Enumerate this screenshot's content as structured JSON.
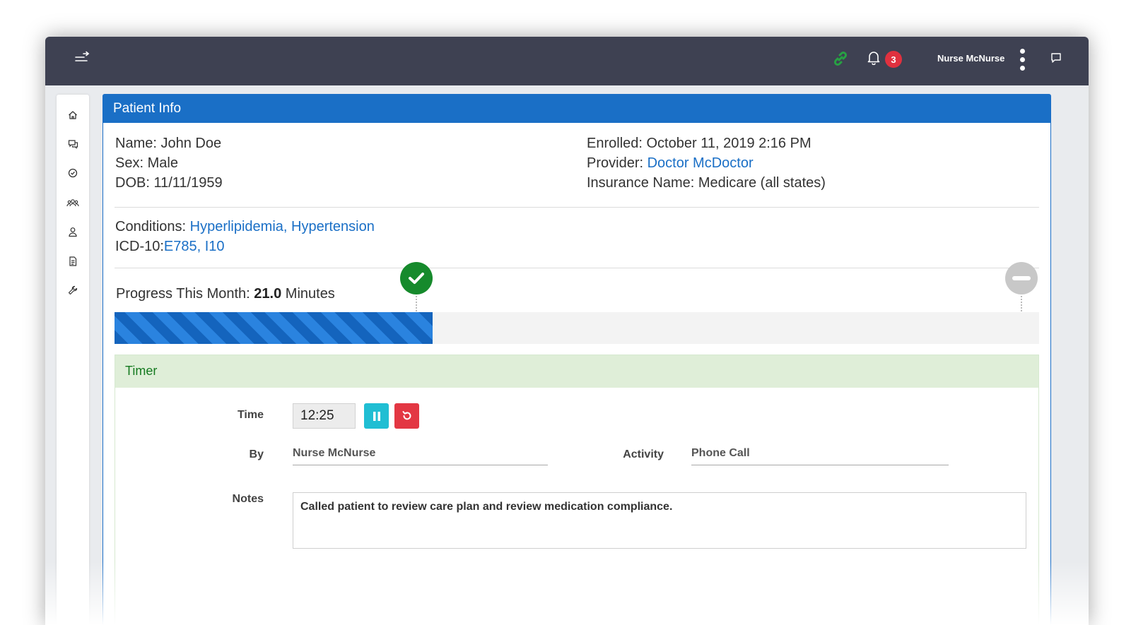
{
  "topbar": {
    "notification_count": "3",
    "user_name": "Nurse McNurse",
    "connection_color": "#27a243"
  },
  "sidebar": {
    "items": [
      {
        "icon": "home-icon"
      },
      {
        "icon": "chat-icon"
      },
      {
        "icon": "check-circle-icon"
      },
      {
        "icon": "group-icon"
      },
      {
        "icon": "user-icon"
      },
      {
        "icon": "document-icon"
      },
      {
        "icon": "wrench-icon"
      }
    ]
  },
  "patient": {
    "header": "Patient Info",
    "name_label": "Name:",
    "name": "John Doe",
    "sex_label": "Sex:",
    "sex": "Male",
    "dob_label": "DOB:",
    "dob": "11/11/1959",
    "enrolled_label": "Enrolled:",
    "enrolled": "October 11, 2019 2:16 PM",
    "provider_label": "Provider:",
    "provider": "Doctor McDoctor",
    "insurance_label": "Insurance Name:",
    "insurance": "Medicare (all states)",
    "conditions_label": "Conditions:",
    "conditions": "Hyperlipidemia, Hypertension",
    "icd_label": "ICD-10:",
    "icd": "E785, I10"
  },
  "progress": {
    "label": "Progress This Month:",
    "value": "21.0",
    "unit": "Minutes",
    "fill_fraction": 0.344
  },
  "timer": {
    "header": "Timer",
    "time_label": "Time",
    "time_value": "12:25",
    "by_label": "By",
    "by_value": "Nurse McNurse",
    "activity_label": "Activity",
    "activity_value": "Phone Call",
    "notes_label": "Notes",
    "notes_value": "Called patient to review care plan and review medication compliance."
  }
}
